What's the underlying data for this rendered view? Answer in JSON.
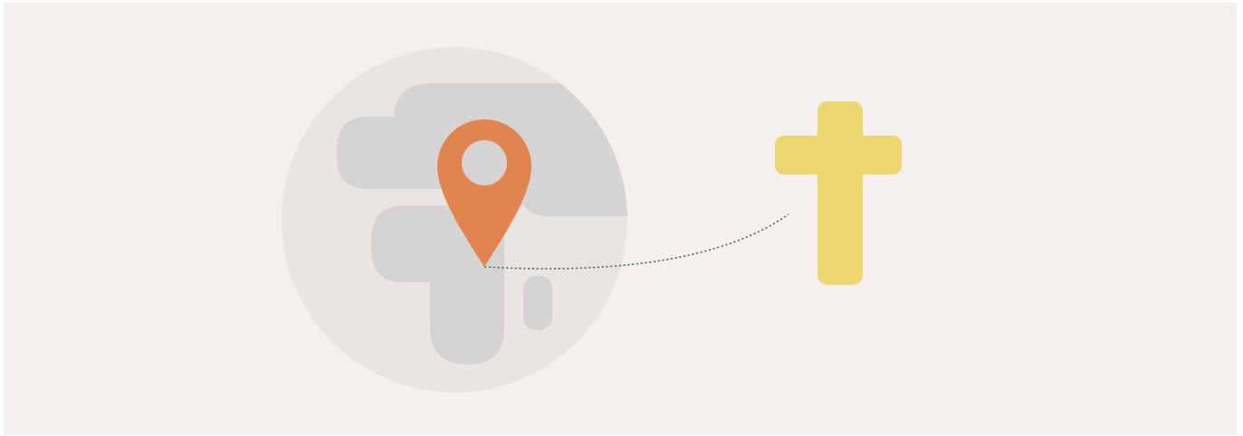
{
  "illustration": {
    "background_color": "#f3f0ed",
    "globe": {
      "icon": "globe-icon",
      "circle_color": "#e8e5e3",
      "landmass_color": "#d5d4d2"
    },
    "location_pin": {
      "icon": "map-pin-icon",
      "color": "#e2844f",
      "hole_color": "#d5d4d2"
    },
    "route_line": {
      "style": "dotted",
      "color": "#4f6d5b"
    },
    "cross": {
      "icon": "cross-icon",
      "color": "#eed570"
    }
  }
}
